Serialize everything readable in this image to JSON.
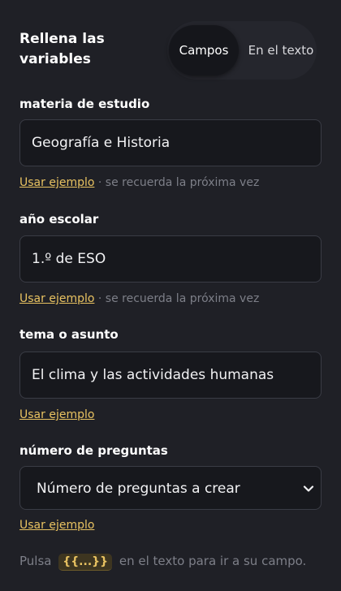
{
  "panel": {
    "title": "Rellena las variables"
  },
  "view_toggle": {
    "fields_label": "Campos",
    "text_label": "En el texto",
    "selected": "Campos"
  },
  "fields": [
    {
      "label": "materia de estudio",
      "value": "Geografía e Historia",
      "example_link": "Usar ejemplo",
      "separator": "·",
      "remember_note": "se recuerda la próxima vez"
    },
    {
      "label": "año escolar",
      "value": "1.º de ESO",
      "example_link": "Usar ejemplo",
      "separator": "·",
      "remember_note": "se recuerda la próxima vez"
    },
    {
      "label": "tema o asunto",
      "value": "El clima y las actividades humanas",
      "example_link": "Usar ejemplo"
    },
    {
      "label": "número de preguntas",
      "select_value": "Número de preguntas a crear",
      "example_link": "Usar ejemplo"
    }
  ],
  "footer": {
    "prefix": "Pulsa",
    "token": "{{...}}",
    "suffix": "en el texto para ir a su campo."
  },
  "icons": {
    "select_arrow": "chevron-down-icon"
  },
  "colors": {
    "background": "#1f2026",
    "input_background": "#17181d",
    "accent": "#e8c261",
    "muted_text": "#7d7f88"
  }
}
